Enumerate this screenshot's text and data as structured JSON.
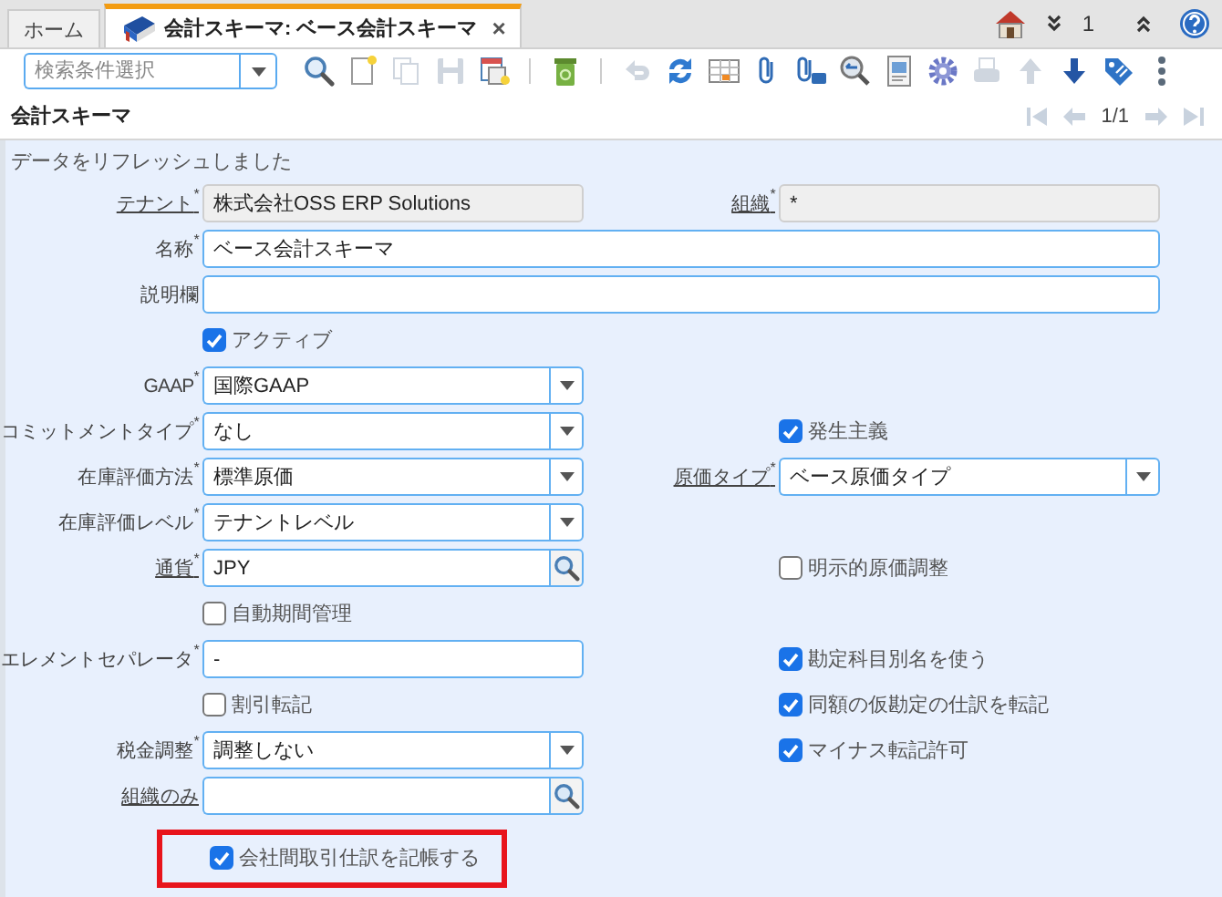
{
  "tabs": [
    {
      "label": "ホーム",
      "selected": false
    },
    {
      "label": "会計スキーマ: ベース会計スキーマ",
      "selected": true,
      "close": "×"
    }
  ],
  "header_right": {
    "count": "1"
  },
  "search": {
    "placeholder": "検索条件選択"
  },
  "toolbar": [
    {
      "kind": "search",
      "disabled": false
    },
    {
      "kind": "new",
      "disabled": false
    },
    {
      "kind": "copy",
      "disabled": true
    },
    {
      "kind": "save",
      "disabled": true
    },
    {
      "kind": "window",
      "disabled": false
    },
    {
      "kind": "sep"
    },
    {
      "kind": "delete",
      "disabled": false
    },
    {
      "kind": "sep"
    },
    {
      "kind": "undo",
      "disabled": true
    },
    {
      "kind": "refresh",
      "disabled": false
    },
    {
      "kind": "grid",
      "disabled": false
    },
    {
      "kind": "attach",
      "disabled": false
    },
    {
      "kind": "attachnote",
      "disabled": false
    },
    {
      "kind": "zoom",
      "disabled": false
    },
    {
      "kind": "report",
      "disabled": false
    },
    {
      "kind": "gear",
      "disabled": false
    },
    {
      "kind": "print",
      "disabled": true
    },
    {
      "kind": "up",
      "disabled": true
    },
    {
      "kind": "down",
      "disabled": false
    },
    {
      "kind": "tag",
      "disabled": false
    },
    {
      "kind": "more",
      "disabled": false
    }
  ],
  "title": "会計スキーマ",
  "pager": {
    "position": "1/1"
  },
  "status": "データをリフレッシュしました",
  "form": {
    "rows": [
      {
        "primary": {
          "label": "テナント$^{*}$",
          "link": true,
          "kind": "readonly",
          "value": "株式会社OSS ERP Solutions"
        },
        "secondary": {
          "label": "組織$^{*}$",
          "link": true,
          "kind": "readonly",
          "value": "*"
        }
      },
      {
        "primary": {
          "label": "名称$^{*}$",
          "link": false,
          "kind": "long_text",
          "value": "ベース会計スキーマ"
        }
      },
      {
        "primary": {
          "label": "説明欄",
          "link": false,
          "kind": "long_text"
        }
      },
      {
        "primary": {
          "kind": "checkbox",
          "label": "アクティブ",
          "checked": true
        }
      },
      {
        "primary": {
          "label": "GAAP$^{*}$",
          "link": false,
          "kind": "select",
          "value": "国際GAAP"
        }
      },
      {
        "primary": {
          "label": "コミットメントタイプ$^{*}$",
          "link": false,
          "kind": "select",
          "value": "なし"
        },
        "secondary": {
          "kind": "checkbox",
          "label": "発生主義",
          "checked": true
        }
      },
      {
        "primary": {
          "label": "在庫評価方法$^{*}$",
          "link": false,
          "kind": "select",
          "value": "標準原価"
        },
        "secondary": {
          "label": "原価タイプ$^{*}$",
          "link": true,
          "kind": "select",
          "value": "ベース原価タイプ"
        }
      },
      {
        "primary": {
          "label": "在庫評価レベル$^{*}$",
          "link": false,
          "kind": "select",
          "value": "テナントレベル"
        }
      },
      {
        "primary": {
          "label": "通貨$^{*}$",
          "link": true,
          "kind": "lookup",
          "value": "JPY"
        },
        "secondary": {
          "kind": "checkbox",
          "label": "明示的原価調整",
          "checked": false
        }
      },
      {
        "primary": {
          "kind": "checkbox",
          "label": "自動期間管理",
          "checked": false
        }
      },
      {
        "primary": {
          "label": "エレメントセパレータ$^{*}$",
          "link": false,
          "kind": "text",
          "value": "-"
        },
        "secondary": {
          "kind": "checkbox",
          "label": "勘定科目別名を使う",
          "checked": true
        }
      },
      {
        "primary": {
          "kind": "checkbox",
          "label": "割引転記",
          "checked": false
        },
        "secondary": {
          "kind": "checkbox",
          "label": "同額の仮勘定の仕訳を転記",
          "checked": true
        }
      },
      {
        "primary": {
          "label": "税金調整$^{*}$",
          "link": false,
          "kind": "select",
          "value": "調整しない"
        },
        "secondary": {
          "kind": "checkbox",
          "label": "マイナス転記許可",
          "checked": true
        }
      },
      {
        "primary": {
          "label": "組織のみ",
          "link": true,
          "kind": "lookup"
        }
      },
      {
        "primary": {
          "kind": "checkbox",
          "label": "会社間取引仕訳を記帳する",
          "checked": true,
          "highlighted": true
        }
      }
    ]
  }
}
